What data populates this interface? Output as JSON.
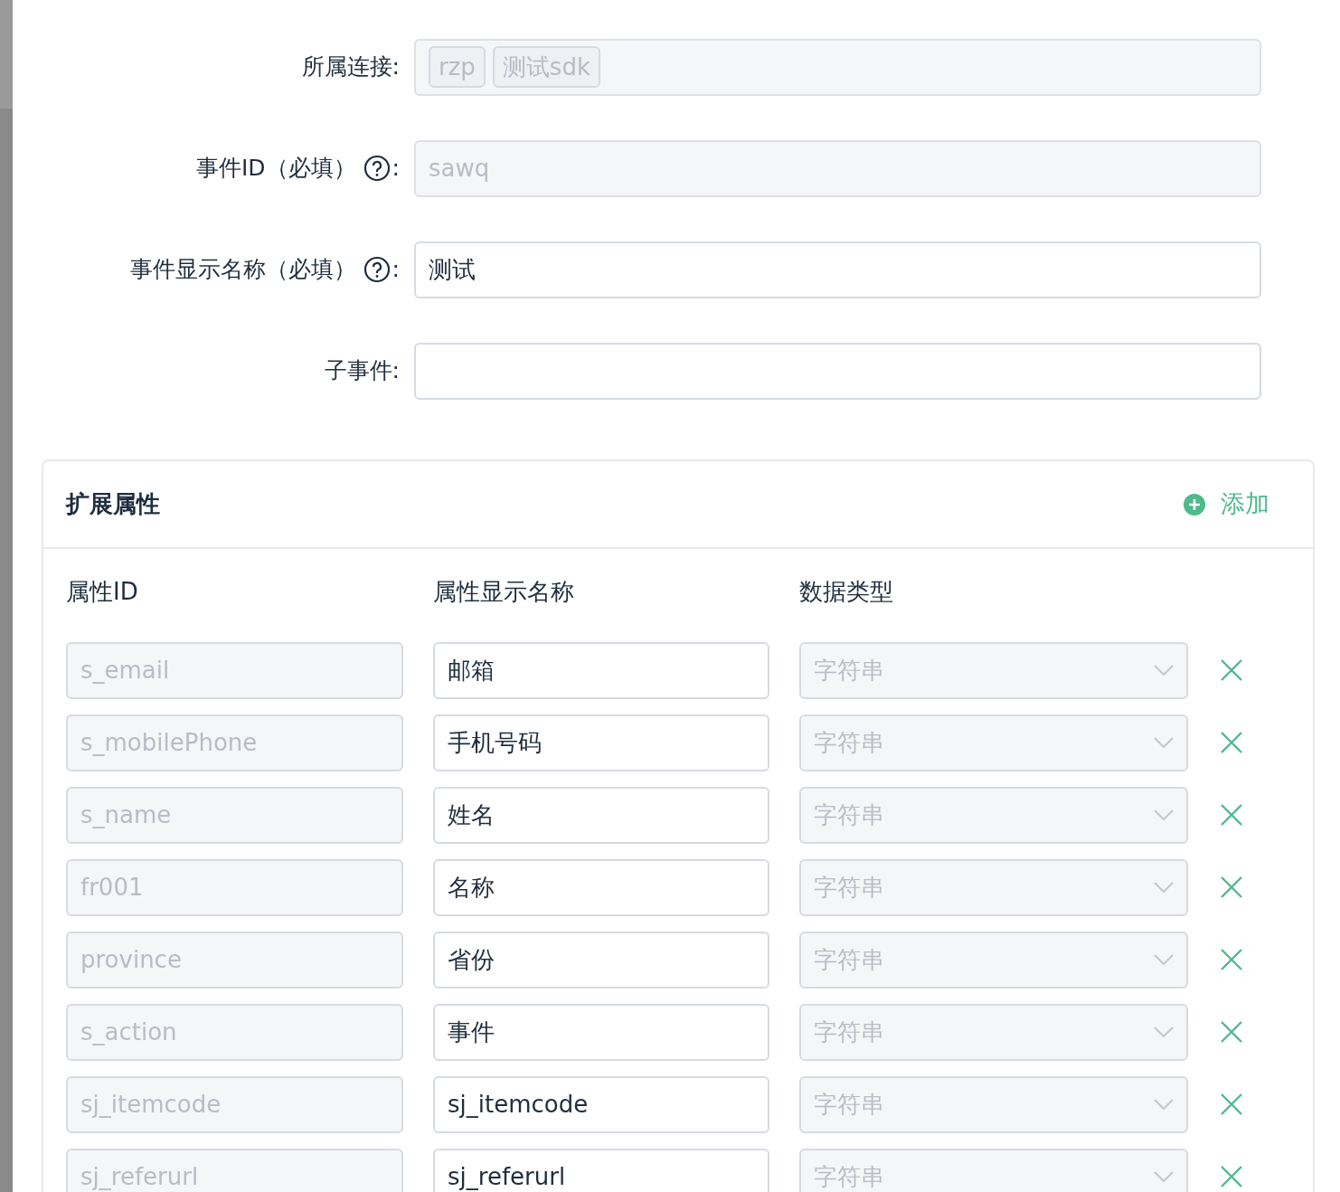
{
  "form": {
    "fields": [
      {
        "label": "所属连接:",
        "kind": "tags",
        "tags": [
          "rzp",
          "测试sdk"
        ],
        "disabled": true,
        "help": false
      },
      {
        "label": "事件ID（必填）",
        "colon": ":",
        "kind": "input",
        "value": "sawq",
        "disabled": true,
        "help": true
      },
      {
        "label": "事件显示名称（必填）",
        "colon": ":",
        "kind": "input",
        "value": "测试",
        "disabled": false,
        "help": true
      },
      {
        "label": "子事件:",
        "kind": "input",
        "help": false
      }
    ]
  },
  "extended_properties": {
    "title": "扩展属性",
    "add_button": "添加",
    "columns": [
      "属性ID",
      "属性显示名称",
      "数据类型"
    ],
    "rows": [
      {
        "id": "s_email",
        "name": "邮箱",
        "type": "字符串"
      },
      {
        "id": "s_mobilePhone",
        "name": "手机号码",
        "type": "字符串"
      },
      {
        "id": "s_name",
        "name": "姓名",
        "type": "字符串"
      },
      {
        "id": "fr001",
        "name": "名称",
        "type": "字符串"
      },
      {
        "id": "province",
        "name": "省份",
        "type": "字符串"
      },
      {
        "id": "s_action",
        "name": "事件",
        "type": "字符串"
      },
      {
        "id": "sj_itemcode",
        "name": "sj_itemcode",
        "type": "字符串"
      },
      {
        "id": "sj_referurl",
        "name": "sj_referurl",
        "type": "字符串"
      }
    ]
  }
}
